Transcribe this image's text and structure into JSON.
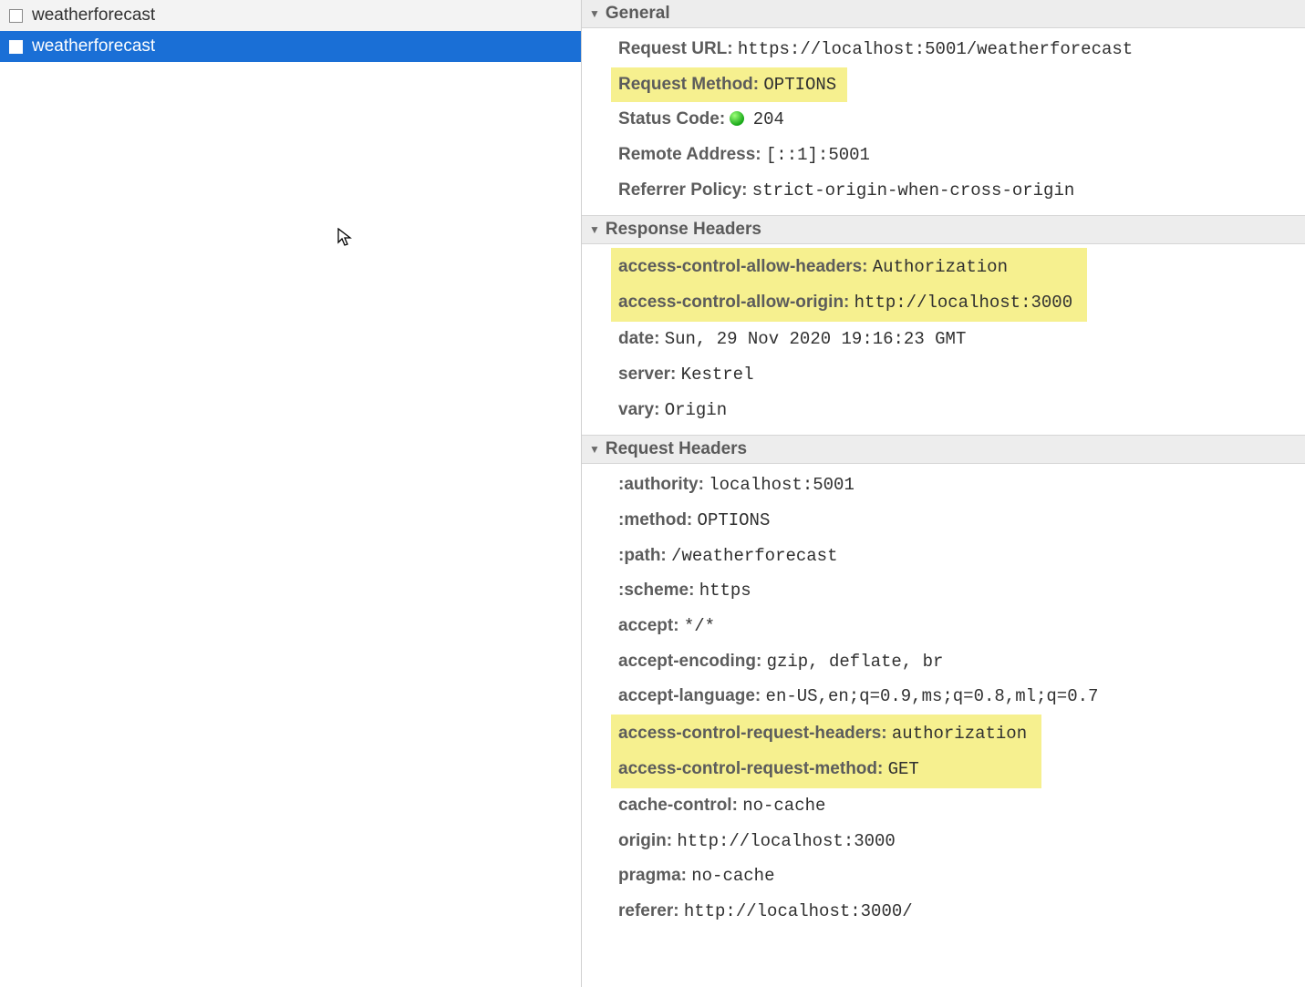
{
  "requests": [
    {
      "name": "weatherforecast",
      "selected": false
    },
    {
      "name": "weatherforecast",
      "selected": true
    }
  ],
  "sections": {
    "general": {
      "title": "General",
      "request_url_label": "Request URL:",
      "request_url": "https://localhost:5001/weatherforecast",
      "request_method_label": "Request Method:",
      "request_method": "OPTIONS",
      "status_code_label": "Status Code:",
      "status_code": "204",
      "remote_address_label": "Remote Address:",
      "remote_address": "[::1]:5001",
      "referrer_policy_label": "Referrer Policy:",
      "referrer_policy": "strict-origin-when-cross-origin"
    },
    "response_headers": {
      "title": "Response Headers",
      "rows": [
        {
          "k": "access-control-allow-headers:",
          "v": "Authorization",
          "hl": true
        },
        {
          "k": "access-control-allow-origin:",
          "v": "http://localhost:3000",
          "hl": true
        },
        {
          "k": "date:",
          "v": "Sun, 29 Nov 2020 19:16:23 GMT",
          "hl": false
        },
        {
          "k": "server:",
          "v": "Kestrel",
          "hl": false
        },
        {
          "k": "vary:",
          "v": "Origin",
          "hl": false
        }
      ]
    },
    "request_headers": {
      "title": "Request Headers",
      "rows": [
        {
          "k": ":authority:",
          "v": "localhost:5001",
          "hl": false
        },
        {
          "k": ":method:",
          "v": "OPTIONS",
          "hl": false
        },
        {
          "k": ":path:",
          "v": "/weatherforecast",
          "hl": false
        },
        {
          "k": ":scheme:",
          "v": "https",
          "hl": false
        },
        {
          "k": "accept:",
          "v": "*/*",
          "hl": false
        },
        {
          "k": "accept-encoding:",
          "v": "gzip, deflate, br",
          "hl": false
        },
        {
          "k": "accept-language:",
          "v": "en-US,en;q=0.9,ms;q=0.8,ml;q=0.7",
          "hl": false
        },
        {
          "k": "access-control-request-headers:",
          "v": "authorization",
          "hl": true
        },
        {
          "k": "access-control-request-method:",
          "v": "GET",
          "hl": true
        },
        {
          "k": "cache-control:",
          "v": "no-cache",
          "hl": false
        },
        {
          "k": "origin:",
          "v": "http://localhost:3000",
          "hl": false
        },
        {
          "k": "pragma:",
          "v": "no-cache",
          "hl": false
        },
        {
          "k": "referer:",
          "v": "http://localhost:3000/",
          "hl": false
        }
      ]
    }
  }
}
